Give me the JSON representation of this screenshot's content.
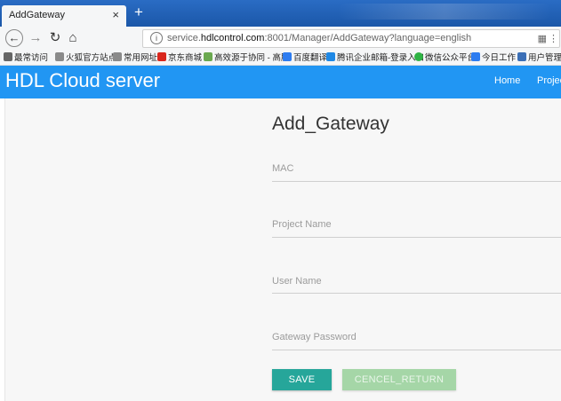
{
  "browser": {
    "tab_title": "AddGateway",
    "tab_close": "×",
    "new_tab": "+",
    "url_prefix": "service.",
    "url_domain": "hdlcontrol.com",
    "url_path": ":8001/Manager/AddGateway?language=english"
  },
  "bookmarks": [
    {
      "label": "最常访问",
      "color": "#666666"
    },
    {
      "label": "火狐官方站点",
      "color": "#8a8a8a"
    },
    {
      "label": "常用网址",
      "color": "#8a8a8a"
    },
    {
      "label": "京东商城",
      "color": "#d9261c"
    },
    {
      "label": "高效源于协同 - 高胜",
      "color": "#6aa84f"
    },
    {
      "label": "百度翻译",
      "color": "#2d7cf0"
    },
    {
      "label": "腾讯企业邮箱-登录入口",
      "color": "#1e88e5"
    },
    {
      "label": "微信公众平台",
      "color": "#2fb344"
    },
    {
      "label": "今日工作",
      "color": "#2d7cf0"
    },
    {
      "label": "用户管理平",
      "color": "#3b6fb6"
    }
  ],
  "app": {
    "brand": "HDL Cloud server",
    "nav_home": "Home",
    "nav_project": "Projec"
  },
  "form": {
    "title": "Add_Gateway",
    "mac_label": "MAC",
    "project_name_label": "Project Name",
    "user_name_label": "User Name",
    "gateway_password_label": "Gateway Password",
    "save_label": "SAVE",
    "cancel_label": "CENCEL_RETURN"
  },
  "colors": {
    "header_blue": "#2196f3",
    "save_teal": "#26a69a",
    "cancel_green": "#a5d6a7"
  }
}
